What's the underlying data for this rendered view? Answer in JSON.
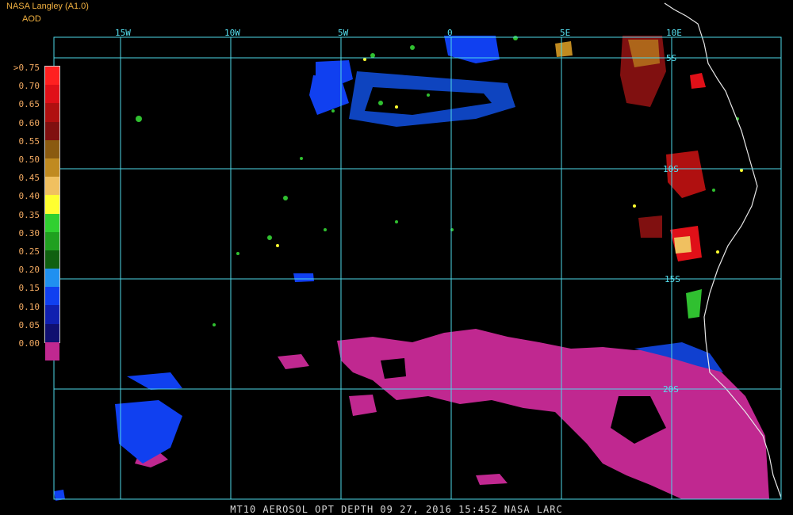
{
  "header": {
    "title": "NASA Langley (A1.0)",
    "product": "AOD"
  },
  "legend": {
    "entries": [
      {
        "label": ">0.75",
        "color": "#ff2020"
      },
      {
        "label": "0.70",
        "color": "#e01018"
      },
      {
        "label": "0.65",
        "color": "#b01010"
      },
      {
        "label": "0.60",
        "color": "#801010"
      },
      {
        "label": "0.55",
        "color": "#8a5a10"
      },
      {
        "label": "0.50",
        "color": "#c08a20"
      },
      {
        "label": "0.45",
        "color": "#f0c060"
      },
      {
        "label": "0.40",
        "color": "#ffff30"
      },
      {
        "label": "0.35",
        "color": "#30d030"
      },
      {
        "label": "0.30",
        "color": "#20a020"
      },
      {
        "label": "0.25",
        "color": "#106010"
      },
      {
        "label": "0.20",
        "color": "#2090f0"
      },
      {
        "label": "0.15",
        "color": "#1040f0"
      },
      {
        "label": "0.10",
        "color": "#1020b0"
      },
      {
        "label": "0.05",
        "color": "#101070"
      },
      {
        "label": "0.00",
        "color": "#c02890"
      }
    ]
  },
  "grid": {
    "longitudes": [
      "15W",
      "10W",
      "5W",
      "0",
      "5E",
      "10E"
    ],
    "latitudes": [
      "5S",
      "10S",
      "15S",
      "20S"
    ],
    "line_color": "#4ed8e8"
  },
  "footer": {
    "text": "MT10  AEROSOL OPT DEPTH   09 27, 2016 15:45Z   NASA LARC"
  }
}
